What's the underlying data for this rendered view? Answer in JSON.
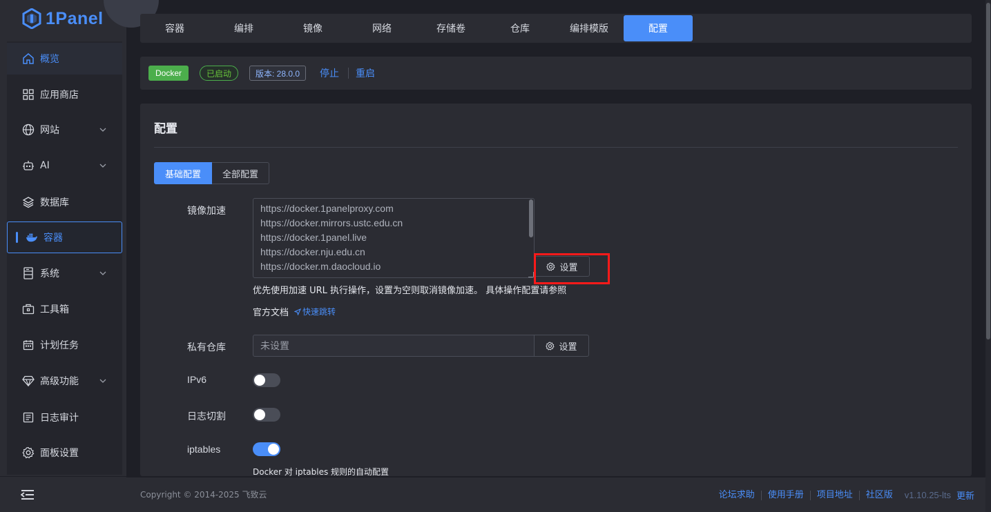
{
  "brand": {
    "name": "1Panel"
  },
  "sidebar": {
    "items": [
      {
        "label": "概览",
        "icon": "home-icon"
      },
      {
        "label": "应用商店",
        "icon": "grid-icon"
      },
      {
        "label": "网站",
        "icon": "globe-icon"
      },
      {
        "label": "AI",
        "icon": "robot-icon"
      },
      {
        "label": "数据库",
        "icon": "layers-icon"
      },
      {
        "label": "容器",
        "icon": "docker-icon"
      },
      {
        "label": "系统",
        "icon": "server-icon"
      },
      {
        "label": "工具箱",
        "icon": "toolbox-icon"
      },
      {
        "label": "计划任务",
        "icon": "calendar-icon"
      },
      {
        "label": "高级功能",
        "icon": "diamond-icon"
      },
      {
        "label": "日志审计",
        "icon": "log-icon"
      },
      {
        "label": "面板设置",
        "icon": "gear-icon"
      }
    ],
    "active": "容器"
  },
  "tabs": [
    "容器",
    "编排",
    "镜像",
    "网络",
    "存储卷",
    "仓库",
    "编排模版",
    "配置"
  ],
  "active_tab": "配置",
  "status": {
    "docker_tag": "Docker",
    "state": "已启动",
    "version": "版本: 28.0.0",
    "stop": "停止",
    "restart": "重启"
  },
  "config": {
    "title": "配置",
    "seg_basic": "基础配置",
    "seg_all": "全部配置",
    "mirror_label": "镜像加速",
    "mirrors": [
      "https://docker.1panelproxy.com",
      "https://docker.mirrors.ustc.edu.cn",
      "https://docker.1panel.live",
      "https://docker.nju.edu.cn",
      "https://docker.m.daocloud.io"
    ],
    "set_label": "设置",
    "help": "优先使用加速 URL 执行操作，设置为空则取消镜像加速。 具体操作配置请参照",
    "doc_label": "官方文档",
    "doc_link": "快速跳转",
    "repo_label": "私有仓库",
    "repo_value": "未设置",
    "ipv6_label": "IPv6",
    "ipv6_on": false,
    "log_label": "日志切割",
    "log_on": false,
    "iptables_label": "iptables",
    "iptables_on": true,
    "iptables_hint": "Docker 对 iptables 规则的自动配置"
  },
  "footer": {
    "copyright": "Copyright © 2014-2025 飞致云",
    "links": [
      "论坛求助",
      "使用手册",
      "项目地址",
      "社区版"
    ],
    "version": "v1.10.25-lts",
    "update": "更新"
  },
  "colors": {
    "accent": "#4a8ef9",
    "success": "#4cae4c",
    "highlight": "#ff1a1a"
  }
}
